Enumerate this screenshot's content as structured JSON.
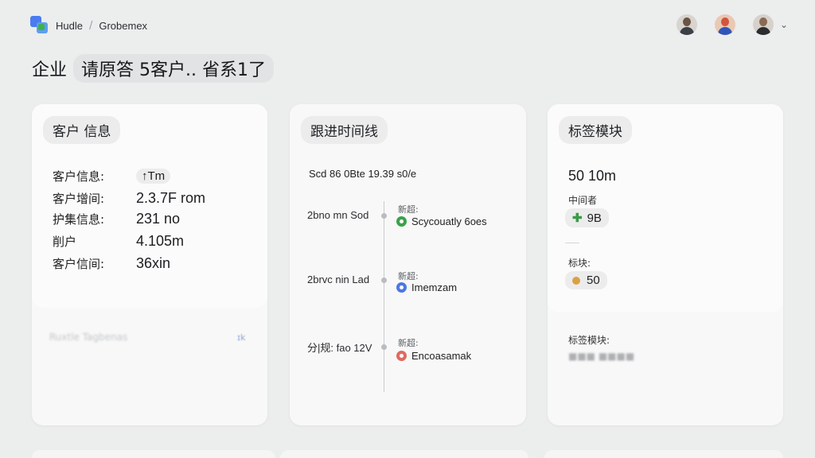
{
  "topbar": {
    "crumb_home": "Hudle",
    "crumb_sep": "/",
    "crumb_current": "Grobemex",
    "chevron": "⌄"
  },
  "page": {
    "title_a": "企业",
    "title_b": "请原答 5客户.. 省系1了"
  },
  "customer_card": {
    "title": "客户 信息",
    "rows": [
      {
        "label": "客户信息:",
        "value": "↑Tm"
      },
      {
        "label": "客户增间:",
        "value": "2.3.7F rom"
      },
      {
        "label": "护集信息:",
        "value": "231 no"
      },
      {
        "label": "削户",
        "value": "4.105m"
      },
      {
        "label": "客户信间:",
        "value": "36xin"
      }
    ],
    "footer_blur": "Ruxtle Tagbenas",
    "footer_mark": "ɪk"
  },
  "timeline_card": {
    "title": "跟进时间线",
    "header": "Scd 86 0Bte 19.39 s0/e",
    "items": [
      {
        "time": "2bno mn Sod",
        "small": "新超:",
        "event": "Scycouatly 6oes",
        "color": "#3aa24a",
        "icon": "check-circle-icon"
      },
      {
        "time": "2brvc nin Lad",
        "small": "新超:",
        "event": "Imemzam",
        "color": "#4c78e2",
        "icon": "info-circle-icon"
      },
      {
        "time": "分|规: fao 12V",
        "small": "新超:",
        "event": "Encoasamak",
        "color": "#e06a61",
        "icon": "alert-circle-icon"
      }
    ]
  },
  "tags_card": {
    "title": "标签模块",
    "total": "50 10m",
    "label_a": "中间者",
    "chip_a": "9B",
    "label_b": "标块:",
    "chip_b": "50",
    "footer_label": "标签模块:",
    "footer_blur": "■■■ ■■■■"
  }
}
